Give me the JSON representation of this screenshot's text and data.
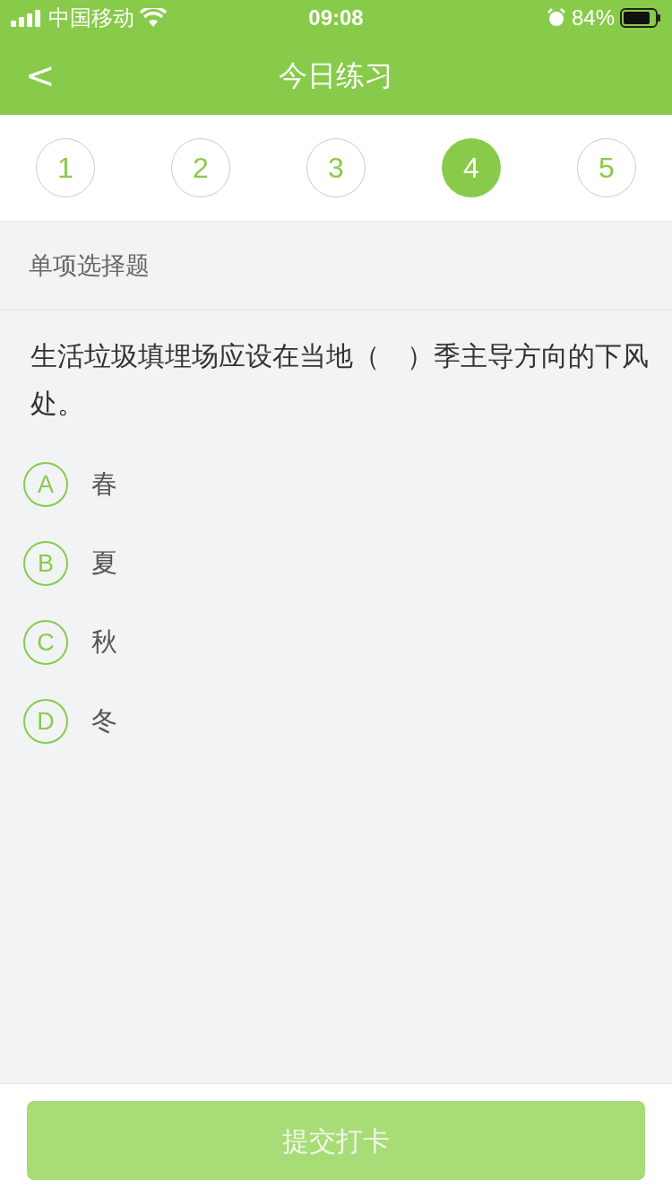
{
  "status_bar": {
    "carrier": "中国移动",
    "time": "09:08",
    "battery": "84%"
  },
  "nav": {
    "back": "<",
    "title": "今日练习"
  },
  "steps": [
    {
      "label": "1",
      "selected": false
    },
    {
      "label": "2",
      "selected": false
    },
    {
      "label": "3",
      "selected": false
    },
    {
      "label": "4",
      "selected": true
    },
    {
      "label": "5",
      "selected": false
    }
  ],
  "section_title": "单项选择题",
  "question": "生活垃圾填埋场应设在当地（　）季主导方向的下风处。",
  "options": [
    {
      "letter": "A",
      "text": "春",
      "selected": false
    },
    {
      "letter": "B",
      "text": "夏",
      "selected": false
    },
    {
      "letter": "C",
      "text": "秋",
      "selected": false
    },
    {
      "letter": "D",
      "text": "冬",
      "selected": false
    }
  ],
  "submit": {
    "label": "提交打卡",
    "disabled": true
  }
}
